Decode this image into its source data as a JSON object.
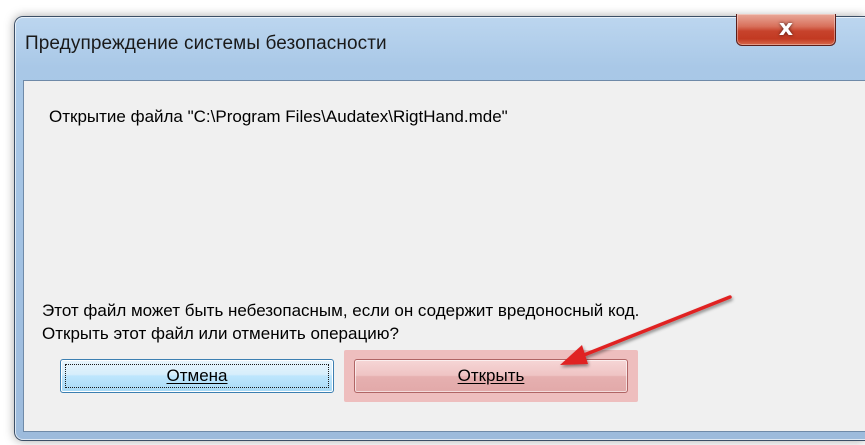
{
  "dialog": {
    "title": "Предупреждение системы безопасности",
    "close_symbol": "x",
    "file_line": "Открытие файла \"C:\\Program Files\\Audatex\\RigtHand.mde\"",
    "warning_lines": [
      "Этот файл может быть небезопасным, если он содержит вредоносный код.",
      "Открыть этот файл или отменить операцию?"
    ],
    "buttons": {
      "cancel_label": "Отмена",
      "open_label": "Открыть"
    }
  },
  "annotation": {
    "arrow_color": "#e02424",
    "highlight_color": "#ec9696",
    "arrow_icon": "red-arrow-icon"
  },
  "colors": {
    "frame": "#a9c8e7",
    "close_button": "#c7432c",
    "client_background": "#f0f0f0",
    "cancel_button": "#bee6fd"
  }
}
